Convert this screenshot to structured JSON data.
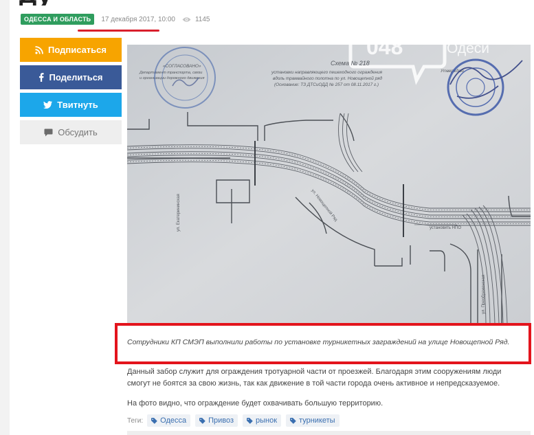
{
  "article": {
    "title_fragment": "ду"
  },
  "meta": {
    "category": "ОДЕССА И ОБЛАСТЬ",
    "date": "17 декабря 2017, 10:00",
    "views": "1145"
  },
  "share": {
    "subscribe": "Подписаться",
    "share": "Поделиться",
    "tweet": "Твитнуть",
    "discuss": "Обсудить"
  },
  "photo": {
    "watermark_number": "048",
    "watermark_city": "Одеси",
    "doc_heading": "Схема № 218",
    "doc_line1": "установки направляющего пешеходного ограждения",
    "doc_line2": "вдоль трамвайного полотна по ул. Новощепной ряд",
    "doc_line3": "(Основание: ТЗ ДТСиОДД № 257 от 08.11.2017 г.)",
    "stamp_left_title": "«СОГЛАСОВАНО»",
    "stamp_left_line1": "Департамент транспорта, связи",
    "stamp_left_line2": "и организации дорожного движения",
    "stamp_right_title": "Утверждаю",
    "street_label_1": "ул. Екатерининская",
    "street_label_2": "ул. Новощепной Ряд",
    "street_label_3": "ул. Преображенская",
    "fence_label": "установить НПО"
  },
  "caption": "Сотрудники КП СМЭП выполнили работы по установке турникетных заграждений на улице Новощепной Ряд.",
  "body": {
    "p1": "Данный забор служит для ограждения тротуарной части от проезжей. Благодаря этим сооружениям люди смогут не боятся за свою жизнь, так как движение в той части города очень активное и непредсказуемое.",
    "p2": "На фото видно, что ограждение будет охвачивать большую территорию."
  },
  "tags": {
    "label": "Теги:",
    "items": [
      "Одесса",
      "Привоз",
      "рынок",
      "турникеты"
    ]
  },
  "colors": {
    "subscribe": "#f7a400",
    "facebook": "#3a5a98",
    "twitter": "#1ca7ea",
    "highlight": "#e3141c",
    "category": "#2f9d5e"
  }
}
